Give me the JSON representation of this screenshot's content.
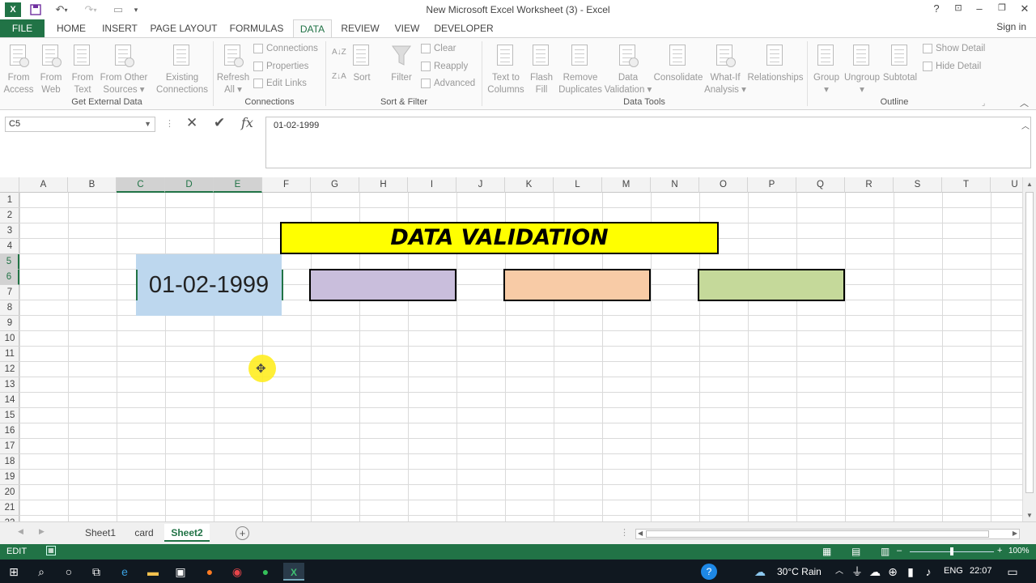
{
  "window": {
    "title": "New Microsoft Excel Worksheet (3) - Excel",
    "help": "?",
    "signin": "Sign in"
  },
  "ribbon_tabs": [
    "FILE",
    "HOME",
    "INSERT",
    "PAGE LAYOUT",
    "FORMULAS",
    "DATA",
    "REVIEW",
    "VIEW",
    "DEVELOPER"
  ],
  "active_tab": "DATA",
  "ribbon": {
    "get_external": {
      "group_label": "Get External Data",
      "buttons": [
        {
          "line1": "From",
          "line2": "Access"
        },
        {
          "line1": "From",
          "line2": "Web"
        },
        {
          "line1": "From",
          "line2": "Text"
        },
        {
          "line1": "From Other",
          "line2": "Sources ▾"
        },
        {
          "line1": "Existing",
          "line2": "Connections"
        }
      ]
    },
    "connections": {
      "group_label": "Connections",
      "refresh": {
        "line1": "Refresh",
        "line2": "All ▾"
      },
      "small": [
        "Connections",
        "Properties",
        "Edit Links"
      ]
    },
    "sort_filter": {
      "group_label": "Sort & Filter",
      "sort": "Sort",
      "filter": "Filter",
      "small": [
        "Clear",
        "Reapply",
        "Advanced"
      ],
      "az": "A↓Z",
      "za": "Z↓A"
    },
    "data_tools": {
      "group_label": "Data Tools",
      "buttons": [
        {
          "line1": "Text to",
          "line2": "Columns"
        },
        {
          "line1": "Flash",
          "line2": "Fill"
        },
        {
          "line1": "Remove",
          "line2": "Duplicates"
        },
        {
          "line1": "Data",
          "line2": "Validation ▾"
        },
        {
          "line1": "Consolidate",
          "line2": ""
        },
        {
          "line1": "What-If",
          "line2": "Analysis ▾"
        },
        {
          "line1": "Relationships",
          "line2": ""
        }
      ]
    },
    "outline": {
      "group_label": "Outline",
      "buttons": [
        {
          "line1": "Group",
          "line2": "▾"
        },
        {
          "line1": "Ungroup",
          "line2": "▾"
        },
        {
          "line1": "Subtotal",
          "line2": ""
        }
      ],
      "small": [
        "Show Detail",
        "Hide Detail"
      ]
    }
  },
  "formula_bar": {
    "name_box": "C5",
    "cancel": "✕",
    "enter": "✔",
    "fx": "fx",
    "formula": "01-02-1999"
  },
  "grid": {
    "columns": [
      "A",
      "B",
      "C",
      "D",
      "E",
      "F",
      "G",
      "H",
      "I",
      "J",
      "K",
      "L",
      "M",
      "N",
      "O",
      "P",
      "Q",
      "R",
      "S",
      "T",
      "U"
    ],
    "rows": [
      "1",
      "2",
      "3",
      "4",
      "5",
      "6",
      "7",
      "8",
      "9",
      "10",
      "11",
      "12",
      "13",
      "14",
      "15",
      "16",
      "17",
      "18",
      "19",
      "20",
      "21",
      "22"
    ],
    "selected_columns": [
      "C",
      "D",
      "E"
    ],
    "selected_rows": [
      "5",
      "6"
    ],
    "title": "DATA VALIDATION",
    "cell_value": "01-02-1999",
    "box_colors": [
      "#c9bedc",
      "#f8cba6",
      "#c5d99a"
    ],
    "title_color": "#ffff00"
  },
  "sheets": {
    "tabs": [
      "Sheet1",
      "card",
      "Sheet2"
    ],
    "active": "Sheet2",
    "add": "+"
  },
  "status": {
    "mode": "EDIT",
    "zoom": "100%"
  },
  "taskbar": {
    "weather": "30°C  Rain",
    "lang": "ENG",
    "time": "22:07"
  }
}
